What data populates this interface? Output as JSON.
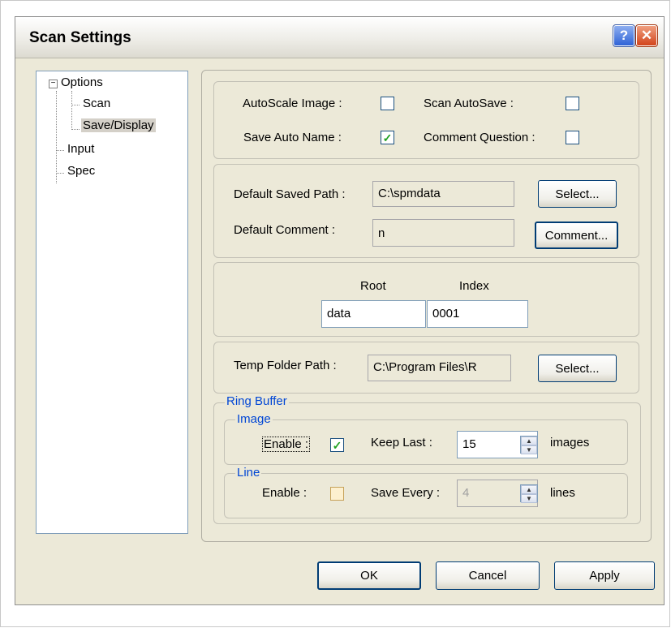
{
  "window": {
    "title": "Scan Settings",
    "help_glyph": "?",
    "close_glyph": "✕"
  },
  "tree": {
    "expander": "−",
    "items": [
      {
        "label": "Options"
      },
      {
        "label": "Scan"
      },
      {
        "label": "Save/Display"
      },
      {
        "label": "Input"
      },
      {
        "label": "Spec"
      }
    ]
  },
  "options": {
    "autoscale_label": "AutoScale Image :",
    "autoscale_checked": false,
    "scan_autosave_label": "Scan AutoSave :",
    "scan_autosave_checked": false,
    "save_auto_name_label": "Save Auto Name :",
    "save_auto_name_checked": true,
    "comment_question_label": "Comment Question :",
    "comment_question_checked": false
  },
  "paths": {
    "default_saved_path_label": "Default Saved Path :",
    "default_saved_path_value": "C:\\spmdata",
    "select_label": "Select...",
    "default_comment_label": "Default Comment :",
    "default_comment_value": "n",
    "comment_button_label": "Comment..."
  },
  "naming": {
    "root_label": "Root",
    "index_label": "Index",
    "root_value": "data",
    "index_value": "0001"
  },
  "temp": {
    "label": "Temp Folder Path :",
    "value": "C:\\Program Files\\R",
    "select_label": "Select..."
  },
  "ring_buffer": {
    "legend": "Ring Buffer",
    "image": {
      "legend": "Image",
      "enable_label": "Enable :",
      "enable_checked": true,
      "keep_last_label": "Keep Last  :",
      "keep_last_value": "15",
      "unit": "images"
    },
    "line": {
      "legend": "Line",
      "enable_label": "Enable :",
      "enable_checked": false,
      "save_every_label": "Save Every :",
      "save_every_value": "4",
      "unit": "lines"
    }
  },
  "footer": {
    "ok": "OK",
    "cancel": "Cancel",
    "apply": "Apply"
  },
  "check_glyph": "✓"
}
